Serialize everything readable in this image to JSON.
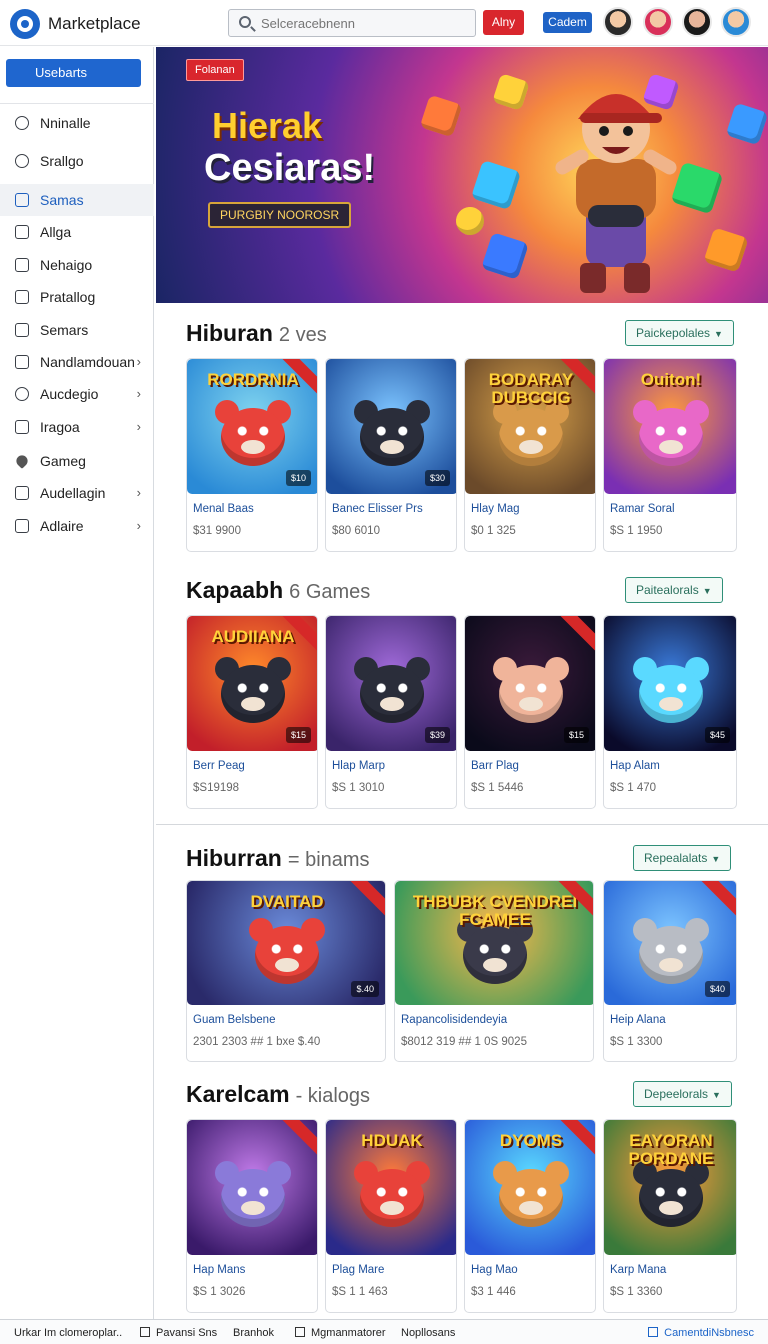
{
  "header": {
    "app_title": "Marketplace",
    "search_placeholder": "Selceracebnenn",
    "red_button": "Alny",
    "blue_button": "Cadem"
  },
  "sidebar": {
    "top_button": "Usebarts",
    "items": [
      {
        "label": "Nninalle",
        "icon": "user-icon",
        "chevron": false,
        "active": false
      },
      {
        "label": "Srallgo",
        "icon": "search-icon",
        "chevron": false,
        "active": false
      },
      {
        "label": "Samas",
        "icon": "home-icon",
        "chevron": false,
        "active": true
      },
      {
        "label": "Allga",
        "icon": "image-icon",
        "chevron": false,
        "active": false
      },
      {
        "label": "Nehaigo",
        "icon": "mail-icon",
        "chevron": false,
        "active": false
      },
      {
        "label": "Pratallog",
        "icon": "key-icon",
        "chevron": false,
        "active": false
      },
      {
        "label": "Semars",
        "icon": "box-icon",
        "chevron": false,
        "active": false
      },
      {
        "label": "Nandlamdouan",
        "icon": "calendar-icon",
        "chevron": true,
        "active": false
      },
      {
        "label": "Aucdegio",
        "icon": "tag-icon",
        "chevron": true,
        "active": false
      },
      {
        "label": "Iragoa",
        "icon": "edit-icon",
        "chevron": true,
        "active": false
      },
      {
        "label": "Gameg",
        "icon": "heart-icon",
        "chevron": false,
        "active": false
      },
      {
        "label": "Audellagin",
        "icon": "folder-icon",
        "chevron": true,
        "active": false
      },
      {
        "label": "Adlaire",
        "icon": "window-icon",
        "chevron": true,
        "active": false
      }
    ]
  },
  "hero": {
    "tag": "Folanan",
    "title_line1": "Hierak",
    "title_line2": "Cesiaras!",
    "cta": "PURGBIY NOOROSR"
  },
  "sections": [
    {
      "title": "Hiburan",
      "subtitle": "2 ves",
      "button": "Paickepolales",
      "cards": [
        {
          "thumb_title": "RORDRNIA",
          "name": "Menal Baas",
          "price": "$31 9900",
          "tag": "$10",
          "color_a": "#7fd3ef",
          "color_b": "#2a8ad6",
          "char": "#e8423a"
        },
        {
          "thumb_title": "",
          "name": "Banec Elisser Prs",
          "price": "$80 6010",
          "tag": "$30",
          "color_a": "#7cc4ff",
          "color_b": "#1d4e9c",
          "char": "#2a2d3a"
        },
        {
          "thumb_title": "BODARAY DUBCCIG",
          "name": "Hlay Mag",
          "price": "$0 1 325",
          "tag": "",
          "color_a": "#d9a24a",
          "color_b": "#6b4a2a",
          "char": "#d99a4a"
        },
        {
          "thumb_title": "Ouiton!",
          "name": "Ramar Soral",
          "price": "$S 1 1950",
          "tag": "",
          "color_a": "#ff9a3c",
          "color_b": "#7a2fb3",
          "char": "#e868c8"
        }
      ]
    },
    {
      "title": "Kapaabh",
      "subtitle": "6 Games",
      "button": "Paitealorals",
      "cards": [
        {
          "thumb_title": "AUDIIANA",
          "name": "Berr Peag",
          "price": "$S19198",
          "tag": "$15",
          "color_a": "#ff8a2a",
          "color_b": "#c21f2a",
          "char": "#2a2d3a"
        },
        {
          "thumb_title": "",
          "name": "Hlap Marp",
          "price": "$S 1 3010",
          "tag": "$39",
          "color_a": "#a06ad9",
          "color_b": "#3a246a",
          "char": "#2a2d3a"
        },
        {
          "thumb_title": "",
          "name": "Barr Plag",
          "price": "$S 1 5446",
          "tag": "$15",
          "color_a": "#3a1a3a",
          "color_b": "#0a0a1a",
          "char": "#f0b49a"
        },
        {
          "thumb_title": "",
          "name": "Hap Alam",
          "price": "$S 1 470",
          "tag": "$45",
          "color_a": "#3a7ad9",
          "color_b": "#0a0a2a",
          "char": "#5ad9ff"
        }
      ]
    },
    {
      "title": "Hiburran",
      "subtitle": "= binams",
      "button": "Repealalats",
      "cards": [
        {
          "thumb_title": "DVAITAD",
          "name": "Guam Belsbene",
          "price": "2301 2303 ## 1 bxe $.40",
          "tag": "$.40",
          "color_a": "#6a8ad9",
          "color_b": "#2a2a6a",
          "char": "#e8423a"
        },
        {
          "thumb_title": "THBUBK  CVENDREI FCAMEE",
          "name": "Rapancolisidendeyia",
          "price": "$8012 319 ## 1 0S 9025",
          "tag": "",
          "color_a": "#ffb84a",
          "color_b": "#3a9a5a",
          "char": "#3a3a4a"
        },
        {
          "thumb_title": "",
          "name": "Heip Alana",
          "price": "$S 1 3300",
          "tag": "$40",
          "color_a": "#7cc4ff",
          "color_b": "#2a6ad9",
          "char": "#b8bcc4"
        }
      ]
    },
    {
      "title": "Karelcam",
      "subtitle": "- kialogs",
      "button": "Depeelorals",
      "cards": [
        {
          "thumb_title": "",
          "name": "Hap Mans",
          "price": "$S 1 3026",
          "tag": "",
          "color_a": "#c07ae8",
          "color_b": "#3a1a6a",
          "char": "#8a7ad9"
        },
        {
          "thumb_title": "HDUAK",
          "name": "Plag Mare",
          "price": "$S 1 1 463",
          "tag": "",
          "color_a": "#ff7a3a",
          "color_b": "#2a2a8a",
          "char": "#e8423a"
        },
        {
          "thumb_title": "DYOMS",
          "name": "Hag Mao",
          "price": "$3 1 446",
          "tag": "",
          "color_a": "#5ad9ff",
          "color_b": "#2a5ad9",
          "char": "#e89a4a"
        },
        {
          "thumb_title": "EAYORAN PORDANE",
          "name": "Karp Mana",
          "price": "$S 1 3360",
          "tag": "",
          "color_a": "#ff9a3a",
          "color_b": "#3a7a3a",
          "char": "#2a2d3a"
        }
      ]
    }
  ],
  "footer": {
    "items": [
      "Urkar Im clomeroplar..",
      "Pavansi Sns",
      "Branhok",
      "Mgmanmatorer",
      "Nopllosans"
    ],
    "right": "CamentdiNsbnesc"
  },
  "colors": {
    "accent": "#1f66cf",
    "danger": "#d9262d",
    "teal": "#2f8f78"
  }
}
